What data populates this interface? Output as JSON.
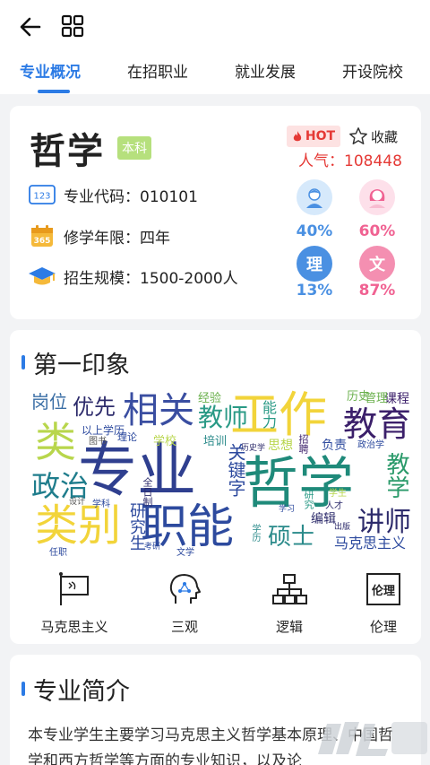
{
  "tabs": [
    "专业概况",
    "在招职业",
    "就业发展",
    "开设院校"
  ],
  "major": {
    "name": "哲学",
    "level_badge": "本科",
    "hot_label": "HOT",
    "favorite_label": "收藏",
    "popularity": "人气：108448",
    "code": "专业代码：010101",
    "duration": "修学年限：四年",
    "enrollment": "招生规模：1500-2000人",
    "male_pct": "40%",
    "female_pct": "60%",
    "science_label": "理",
    "science_pct": "13%",
    "arts_label": "文",
    "arts_pct": "87%"
  },
  "impression": {
    "title": "第一印象",
    "words": {
      "w1": "专业",
      "w2": "哲学",
      "w3": "职能",
      "w4": "工作",
      "w5": "相关",
      "w6": "类别",
      "w7": "类",
      "w8": "教育",
      "w9": "政治",
      "w10": "教师",
      "w11": "讲师",
      "w12": "硕士",
      "w13": "优先",
      "w14": "岗位",
      "w15": "马克思主义",
      "w16": "教学",
      "w17": "研究生",
      "w18": "关键字",
      "w19": "经验",
      "w20": "历史",
      "w21": "课程",
      "w22": "负责",
      "w23": "能力",
      "w24": "思想",
      "w25": "学校",
      "w26": "培训",
      "w27": "编辑",
      "w28": "研究",
      "w29": "以上学历",
      "w30": "全日制",
      "w31": "招聘",
      "w32": "政治学",
      "w33": "学生",
      "w34": "学历",
      "w35": "图书",
      "w36": "管理",
      "w37": "人才",
      "w38": "出版",
      "w39": "学习",
      "w40": "文学",
      "w41": "任职",
      "w42": "学科",
      "w43": "设计",
      "w44": "理论",
      "w45": "历史学",
      "w46": "考研"
    },
    "icons": [
      "马克思主义",
      "三观",
      "逻辑",
      "伦理"
    ],
    "logic_icon_text": "伦理"
  },
  "intro": {
    "title": "专业简介",
    "text": "本专业学生主要学习马克思主义哲学基本原理、中国哲学和西方哲学等方面的专业知识，以及论"
  },
  "colors": {
    "accent": "#2c7be5",
    "hot": "#e53935",
    "male": "#4a90e2",
    "female": "#f06292"
  }
}
